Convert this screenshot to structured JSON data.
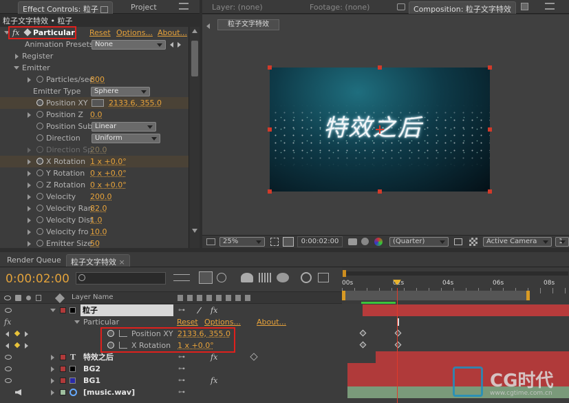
{
  "left_panel": {
    "tab_effect_controls": "Effect Controls: 粒子",
    "tab_project": "Project",
    "breadcrumb": "粒子文字特效 • 粒子",
    "effect": {
      "fx": "fx",
      "name": "Particular",
      "reset": "Reset",
      "options": "Options...",
      "about": "About..."
    },
    "presets": {
      "label": "Animation Presets:",
      "value": "None"
    },
    "register": "Register",
    "emitter": "Emitter",
    "properties": [
      {
        "label": "Particles/sec",
        "value": "800"
      },
      {
        "label": "Emitter Type",
        "value": "Sphere"
      },
      {
        "label": "Position XY",
        "value": "2133.6, 355.0"
      },
      {
        "label": "Position Z",
        "value": "0.0"
      },
      {
        "label": "Position Sub",
        "value": "Linear"
      },
      {
        "label": "Direction",
        "value": "Uniform"
      },
      {
        "label": "Direction Sp",
        "value": "20.0"
      },
      {
        "label": "X Rotation",
        "value": "1 x +0.0°"
      },
      {
        "label": "Y Rotation",
        "value": "0 x +0.0°"
      },
      {
        "label": "Z Rotation",
        "value": "0 x +0.0°"
      },
      {
        "label": "Velocity",
        "value": "200.0"
      },
      {
        "label": "Velocity Ran",
        "value": "82.0"
      },
      {
        "label": "Velocity Dist",
        "value": "1.0"
      },
      {
        "label": "Velocity fro",
        "value": "10.0"
      },
      {
        "label": "Emitter Size",
        "value": "50"
      }
    ]
  },
  "comp_panel": {
    "tab_layer": "Layer: (none)",
    "tab_footage": "Footage: (none)",
    "tab_comp": "Composition: 粒子文字特效",
    "comp_button": "粒子文字特效",
    "preview_text": "特效之后",
    "zoom": "25%",
    "timecode": "0:00:02:00",
    "resolution": "(Quarter)",
    "camera": "Active Camera",
    "views": "1"
  },
  "timeline": {
    "tab_render_queue": "Render Queue",
    "tab_comp": "粒子文字特效",
    "timecode": "0:00:02:00",
    "column_layer_name": "Layer Name",
    "ruler": [
      "00s",
      "02s",
      "04s",
      "06s",
      "08s"
    ],
    "layers": [
      {
        "name": "粒子",
        "color": "#b03a3a"
      },
      {
        "name": "特效之后",
        "color": "#b03a3a"
      },
      {
        "name": "BG2",
        "color": "#b03a3a"
      },
      {
        "name": "BG1",
        "color": "#3a3acc"
      },
      {
        "name": "[music.wav]",
        "color": "#9fbf9f"
      }
    ],
    "effect_row": {
      "name": "Particular",
      "reset": "Reset",
      "options": "Options...",
      "about": "About..."
    },
    "keyed_props": [
      {
        "name": "Position XY",
        "value": "2133.6, 355.0"
      },
      {
        "name": "X Rotation",
        "value": "1 x +0.0°"
      }
    ]
  },
  "watermark": {
    "brand": "CG时代",
    "url": "www.cgtime.com.cn"
  }
}
